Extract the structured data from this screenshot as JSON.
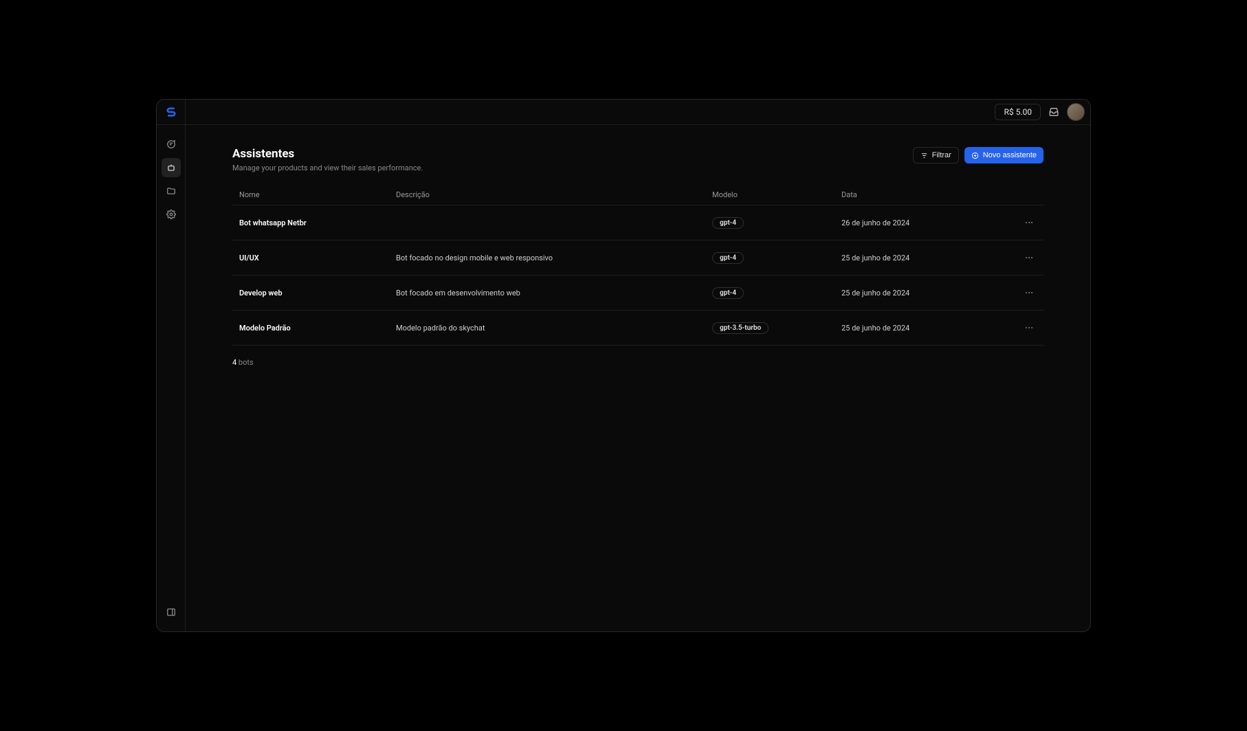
{
  "header": {
    "balance": "R$ 5.00"
  },
  "page": {
    "title": "Assistentes",
    "subtitle": "Manage your products and view their sales performance."
  },
  "actions": {
    "filter_label": "Filtrar",
    "new_label": "Novo assistente"
  },
  "table": {
    "columns": {
      "name": "Nome",
      "description": "Descrição",
      "model": "Modelo",
      "date": "Data"
    },
    "rows": [
      {
        "name": "Bot whatsapp Netbr",
        "description": "",
        "model": "gpt-4",
        "date": "26 de junho de 2024"
      },
      {
        "name": "UI/UX",
        "description": "Bot focado no design mobile e web responsivo",
        "model": "gpt-4",
        "date": "25 de junho de 2024"
      },
      {
        "name": "Develop web",
        "description": "Bot focado em desenvolvimento web",
        "model": "gpt-4",
        "date": "25 de junho de 2024"
      },
      {
        "name": "Modelo Padrão",
        "description": "Modelo padrão do skychat",
        "model": "gpt-3.5-turbo",
        "date": "25 de junho de 2024"
      }
    ]
  },
  "footer": {
    "count": "4",
    "count_label": "bots"
  },
  "icons": {
    "chat": "chat-icon",
    "bot": "bot-icon",
    "folder": "folder-icon",
    "settings": "settings-icon",
    "panel": "panel-icon",
    "filter": "filter-icon",
    "plus": "plus-circle-icon",
    "dots": "dots-icon",
    "inbox": "inbox-icon"
  }
}
